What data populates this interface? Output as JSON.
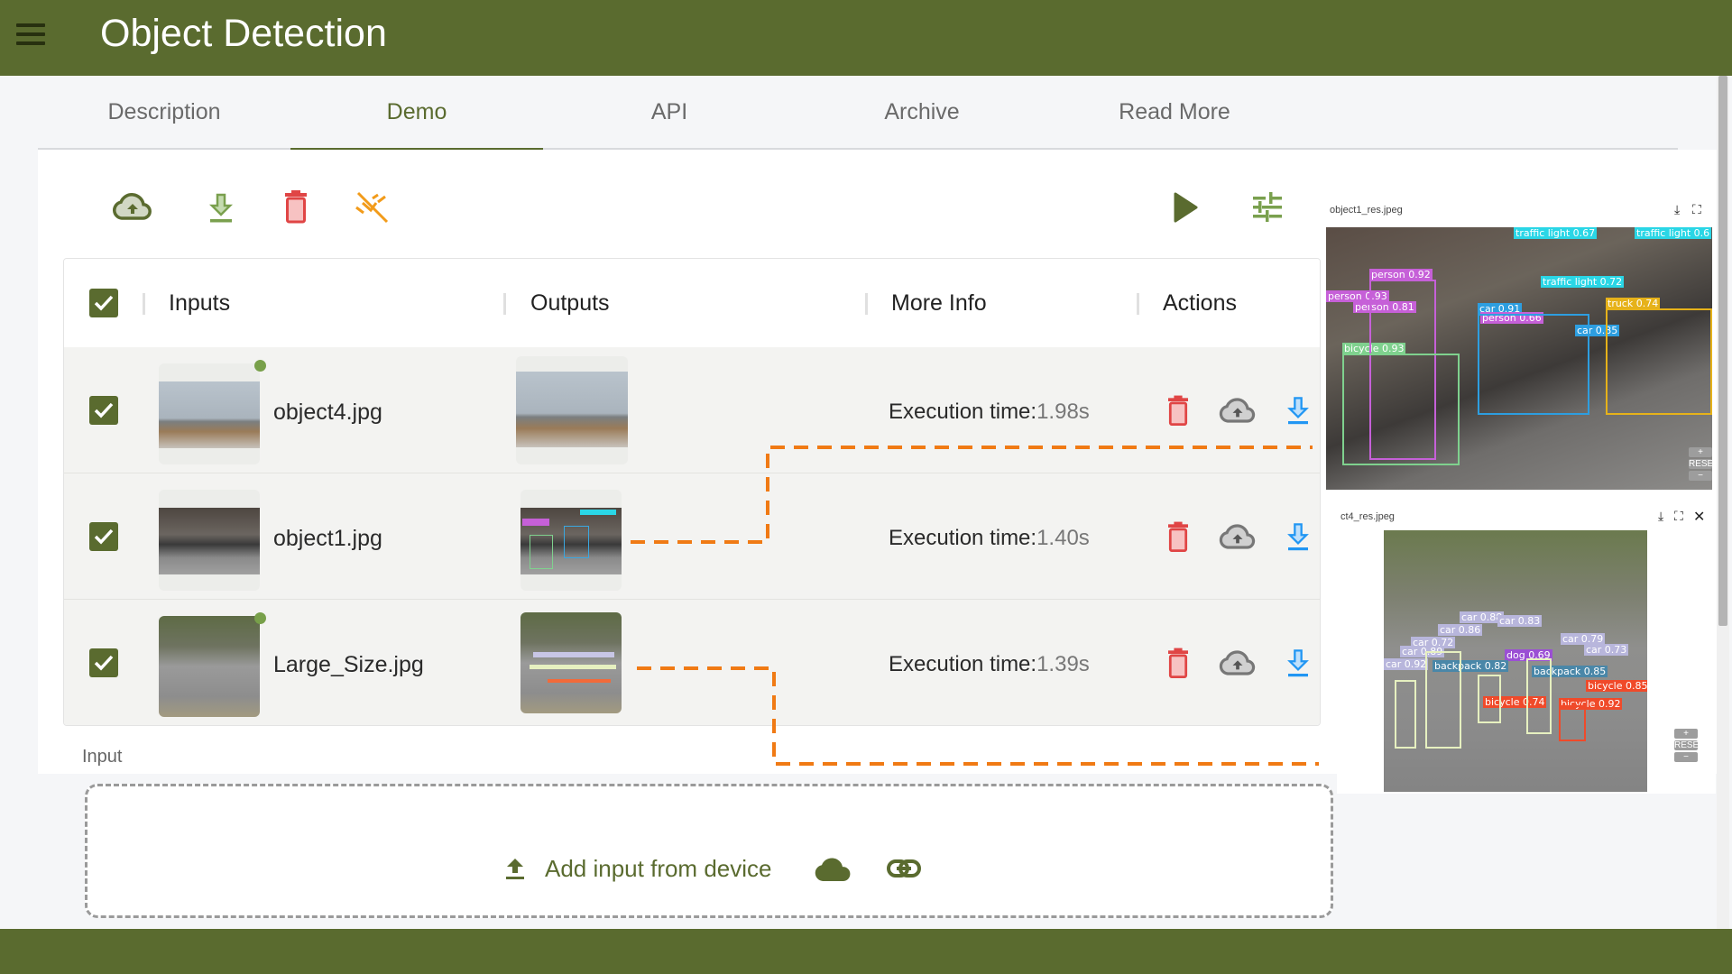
{
  "header": {
    "title": "Object Detection",
    "menu_icon": "hamburger-menu-icon"
  },
  "tabs": [
    {
      "label": "Description",
      "active": false
    },
    {
      "label": "Demo",
      "active": true
    },
    {
      "label": "API",
      "active": false
    },
    {
      "label": "Archive",
      "active": false
    },
    {
      "label": "Read More",
      "active": false
    }
  ],
  "toolbar": {
    "left": [
      {
        "name": "upload-cloud",
        "icon": "cloud-upload-icon",
        "color": "#5a6b2f"
      },
      {
        "name": "download-all",
        "icon": "download-icon",
        "color": "#7aa04e"
      },
      {
        "name": "delete-all",
        "icon": "trash-icon",
        "color": "#e04545"
      },
      {
        "name": "disconnect",
        "icon": "link-off-icon",
        "color": "#f29b1a"
      }
    ],
    "right": [
      {
        "name": "run",
        "icon": "play-icon",
        "color": "#5a6b2f"
      },
      {
        "name": "settings",
        "icon": "tune-sliders-icon",
        "color": "#7aa04e"
      }
    ]
  },
  "table": {
    "select_all_checked": true,
    "columns": [
      "Inputs",
      "Outputs",
      "More Info",
      "Actions"
    ],
    "rows": [
      {
        "checked": true,
        "input": "object4.jpg",
        "new_dot": true,
        "exec_label": "Execution time:",
        "exec_value": "1.98s"
      },
      {
        "checked": true,
        "input": "object1.jpg",
        "new_dot": false,
        "exec_label": "Execution time:",
        "exec_value": "1.40s"
      },
      {
        "checked": true,
        "input": "Large_Size.jpg",
        "new_dot": true,
        "exec_label": "Execution time:",
        "exec_value": "1.39s"
      }
    ],
    "row_actions": [
      {
        "name": "delete",
        "icon": "trash-icon",
        "color": "#e04545"
      },
      {
        "name": "upload",
        "icon": "cloud-upload-icon",
        "color": "#777777"
      },
      {
        "name": "download",
        "icon": "download-icon",
        "color": "#2196f3"
      }
    ]
  },
  "input_section": {
    "label": "Input",
    "add_from_device": "Add input from device",
    "upload_icon": "upload-icon",
    "cloud_icon": "cloud-icon",
    "link_icon": "link-icon"
  },
  "viewers": [
    {
      "filename": "object1_res.jpeg",
      "controls": [
        "download-icon",
        "fullscreen-icon",
        "close-icon"
      ],
      "zoom": {
        "plus": "+",
        "reset": "RESET",
        "minus": "−"
      },
      "labels": [
        "traffic light 0.67",
        "traffic light 0.6",
        "traffic light 0.72",
        "person 0.92",
        "person 0.93",
        "person 0.81",
        "car 0.91",
        "person 0.66",
        "car 0.85",
        "truck 0.74",
        "bicycle 0.93"
      ]
    },
    {
      "filename": "ct4_res.jpeg",
      "controls": [
        "download-icon",
        "fullscreen-icon",
        "close-icon"
      ],
      "zoom": {
        "plus": "+",
        "reset": "RESET",
        "minus": "−"
      },
      "labels": [
        "car 0.88",
        "car 0.83",
        "car 0.86",
        "car 0.72",
        "car 0.89",
        "car 0.92",
        "car 0.79",
        "car 0.73",
        "dog 0.69",
        "backpack 0.82",
        "backpack 0.85",
        "bicycle 0.85",
        "bicycle 0.74",
        "bicycle 0.92"
      ]
    }
  ],
  "colors": {
    "brand": "#5a6b2f",
    "connector": "#f07a14",
    "danger": "#e04545",
    "info": "#2196f3"
  }
}
